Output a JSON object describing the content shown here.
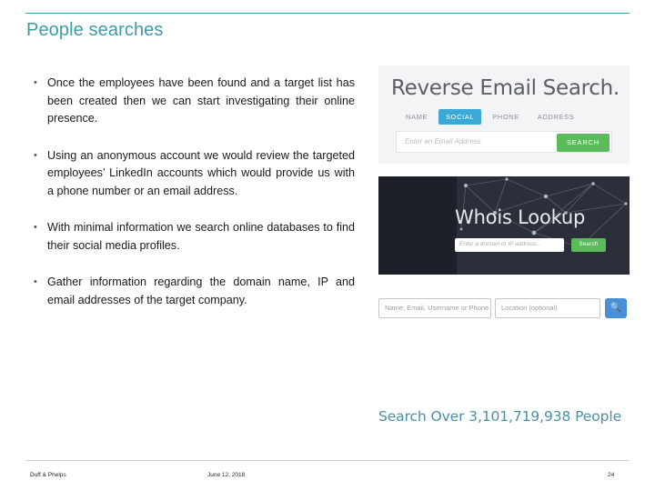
{
  "slide": {
    "title": "People searches",
    "bullets": [
      "Once the employees have been found and a target list has been created then we can start investigating their online presence.",
      "Using an anonymous account we would review the targeted employees’ LinkedIn accounts which would provide us with a phone number or an email address.",
      "With minimal information we search online databases to find their social media profiles.",
      "Gather information regarding the domain name, IP and email addresses of the target company."
    ],
    "bullet_marker": "•"
  },
  "reverse_email_search": {
    "headline": "Reverse Email Search.",
    "tabs": [
      {
        "label": "NAME",
        "active": false
      },
      {
        "label": "SOCIAL",
        "active": true
      },
      {
        "label": "PHONE",
        "active": false
      },
      {
        "label": "ADDRESS",
        "active": false
      }
    ],
    "input_placeholder": "Enter an Email Address",
    "input_value": "",
    "search_button": "SEARCH",
    "accent_color": "#3aa9d6",
    "button_color": "#5bbb5a"
  },
  "whois_lookup": {
    "title": "Whois Lookup",
    "input_placeholder": "Enter a domain or IP address...",
    "input_value": "",
    "button_label": "Search",
    "background_color": "#2b2f3a",
    "button_color": "#5bbb5a"
  },
  "people_search": {
    "name_placeholder": "Name, Email, Username or Phone",
    "location_placeholder": "Location (optional)",
    "name_value": "",
    "location_value": "",
    "search_icon": "🔍",
    "count_text": "Search Over 3,101,719,938 People",
    "count_color": "#4a8fa8"
  },
  "footer": {
    "left": "Duff & Phelps",
    "center": "June 12, 2018",
    "page": "24"
  },
  "theme": {
    "title_color": "#3f9aa8",
    "rule_color": "#3f9aa8"
  }
}
